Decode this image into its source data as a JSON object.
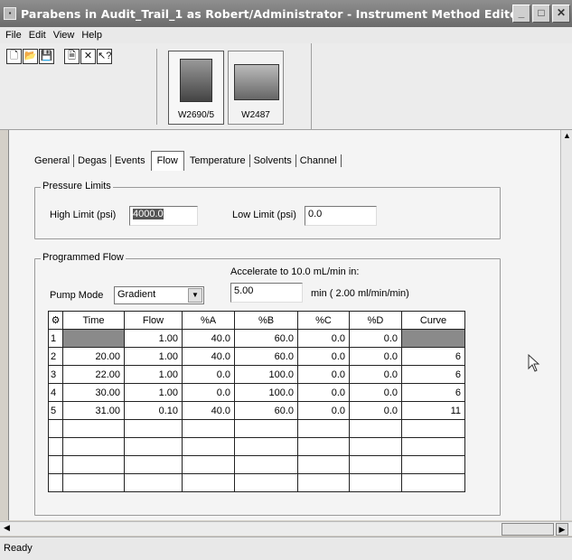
{
  "window": {
    "title": "Parabens in Audit_Trail_1 as Robert/Administrator - Instrument Method Editor",
    "app_icon": "method-editor-icon",
    "min_glyph": "_",
    "max_glyph": "□",
    "close_glyph": "✕"
  },
  "menu": [
    "File",
    "Edit",
    "View",
    "Help"
  ],
  "toolbar": {
    "new": "🗋",
    "open": "📂",
    "save": "💾",
    "properties": "🗎",
    "delete": "✕",
    "help": "↖?"
  },
  "instruments": [
    {
      "label": "W2690/5",
      "selected": true
    },
    {
      "label": "W2487",
      "selected": false
    }
  ],
  "tabs": [
    "General",
    "Degas",
    "Events",
    "Flow",
    "Temperature",
    "Solvents",
    "Channel"
  ],
  "active_tab": "Flow",
  "pressure": {
    "legend": "Pressure Limits",
    "high_label": "High Limit (psi)",
    "high_value": "4000.0",
    "low_label": "Low Limit (psi)",
    "low_value": "0.0"
  },
  "programmed_flow": {
    "legend": "Programmed Flow",
    "accelerate_label": "Accelerate to 10.0 mL/min in:",
    "accelerate_value": "5.00",
    "accelerate_unit": "min (  2.00 ml/min/min)",
    "pump_mode_label": "Pump Mode",
    "pump_mode_value": "Gradient"
  },
  "table": {
    "headers": [
      "Time",
      "Flow",
      "%A",
      "%B",
      "%C",
      "%D",
      "Curve"
    ],
    "rows": [
      {
        "n": "1",
        "time": "",
        "flow": "1.00",
        "a": "40.0",
        "b": "60.0",
        "c": "0.0",
        "d": "0.0",
        "curve": ""
      },
      {
        "n": "2",
        "time": "20.00",
        "flow": "1.00",
        "a": "40.0",
        "b": "60.0",
        "c": "0.0",
        "d": "0.0",
        "curve": "6"
      },
      {
        "n": "3",
        "time": "22.00",
        "flow": "1.00",
        "a": "0.0",
        "b": "100.0",
        "c": "0.0",
        "d": "0.0",
        "curve": "6"
      },
      {
        "n": "4",
        "time": "30.00",
        "flow": "1.00",
        "a": "0.0",
        "b": "100.0",
        "c": "0.0",
        "d": "0.0",
        "curve": "6"
      },
      {
        "n": "5",
        "time": "31.00",
        "flow": "0.10",
        "a": "40.0",
        "b": "60.0",
        "c": "0.0",
        "d": "0.0",
        "curve": "11"
      }
    ]
  },
  "status": "Ready"
}
